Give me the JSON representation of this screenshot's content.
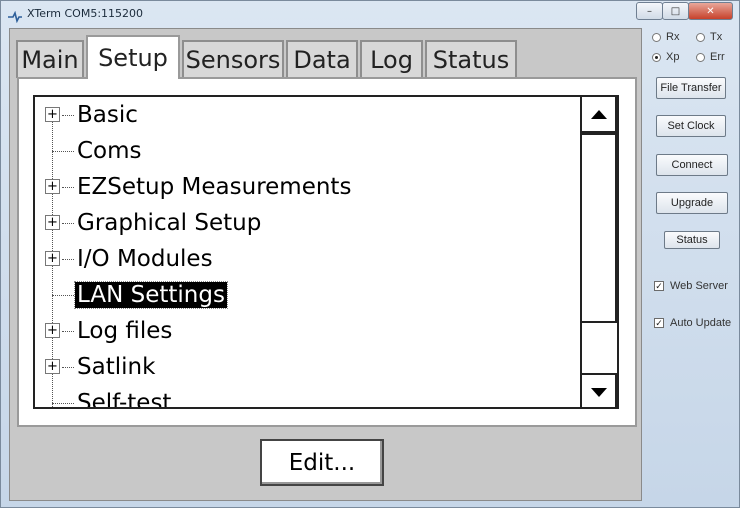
{
  "window": {
    "title": "XTerm COM5:115200",
    "minimize_glyph": "–",
    "maximize_glyph": "□",
    "close_glyph": "✕"
  },
  "tabs": [
    {
      "label": "Main",
      "active": false
    },
    {
      "label": "Setup",
      "active": true
    },
    {
      "label": "Sensors",
      "active": false
    },
    {
      "label": "Data",
      "active": false
    },
    {
      "label": "Log",
      "active": false
    },
    {
      "label": "Status",
      "active": false
    }
  ],
  "tree": {
    "items": [
      {
        "label": "Basic",
        "expandable": true,
        "selected": false
      },
      {
        "label": "Coms",
        "expandable": false,
        "selected": false
      },
      {
        "label": "EZSetup Measurements",
        "expandable": true,
        "selected": false
      },
      {
        "label": "Graphical Setup",
        "expandable": true,
        "selected": false
      },
      {
        "label": "I/O Modules",
        "expandable": true,
        "selected": false
      },
      {
        "label": "LAN Settings",
        "expandable": false,
        "selected": true
      },
      {
        "label": "Log files",
        "expandable": true,
        "selected": false
      },
      {
        "label": "Satlink",
        "expandable": true,
        "selected": false
      },
      {
        "label": "Self-test",
        "expandable": false,
        "selected": false
      }
    ],
    "expander_glyph": "+"
  },
  "edit_button": {
    "label": "Edit..."
  },
  "side": {
    "radios": [
      {
        "label": "Rx",
        "checked": false
      },
      {
        "label": "Tx",
        "checked": false
      },
      {
        "label": "Xp",
        "checked": true
      },
      {
        "label": "Err",
        "checked": false
      }
    ],
    "buttons": {
      "file_transfer": "File Transfer",
      "set_clock": "Set Clock",
      "connect": "Connect",
      "upgrade": "Upgrade",
      "status": "Status"
    },
    "checks": {
      "web_server": {
        "label": "Web Server",
        "checked": true
      },
      "auto_update": {
        "label": "Auto Update",
        "checked": true
      }
    },
    "check_glyph": "✓"
  },
  "colors": {
    "selection_bg": "#000000",
    "selection_fg": "#ffffff",
    "close_button": "#c7412b"
  }
}
